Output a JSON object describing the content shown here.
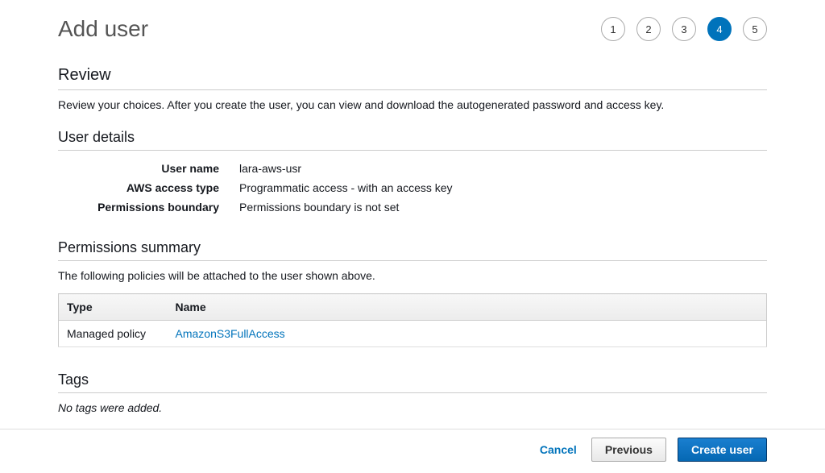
{
  "page": {
    "title": "Add user"
  },
  "wizard": {
    "steps": [
      {
        "label": "1",
        "active": false
      },
      {
        "label": "2",
        "active": false
      },
      {
        "label": "3",
        "active": false
      },
      {
        "label": "4",
        "active": true
      },
      {
        "label": "5",
        "active": false
      }
    ]
  },
  "review": {
    "heading": "Review",
    "description": "Review your choices. After you create the user, you can view and download the autogenerated password and access key."
  },
  "user_details": {
    "heading": "User details",
    "rows": [
      {
        "label": "User name",
        "value": "lara-aws-usr"
      },
      {
        "label": "AWS access type",
        "value": "Programmatic access - with an access key"
      },
      {
        "label": "Permissions boundary",
        "value": "Permissions boundary is not set"
      }
    ]
  },
  "permissions": {
    "heading": "Permissions summary",
    "description": "The following policies will be attached to the user shown above.",
    "columns": {
      "type": "Type",
      "name": "Name"
    },
    "rows": [
      {
        "type": "Managed policy",
        "name": "AmazonS3FullAccess"
      }
    ]
  },
  "tags": {
    "heading": "Tags",
    "empty_message": "No tags were added."
  },
  "footer": {
    "cancel": "Cancel",
    "previous": "Previous",
    "create": "Create user"
  }
}
